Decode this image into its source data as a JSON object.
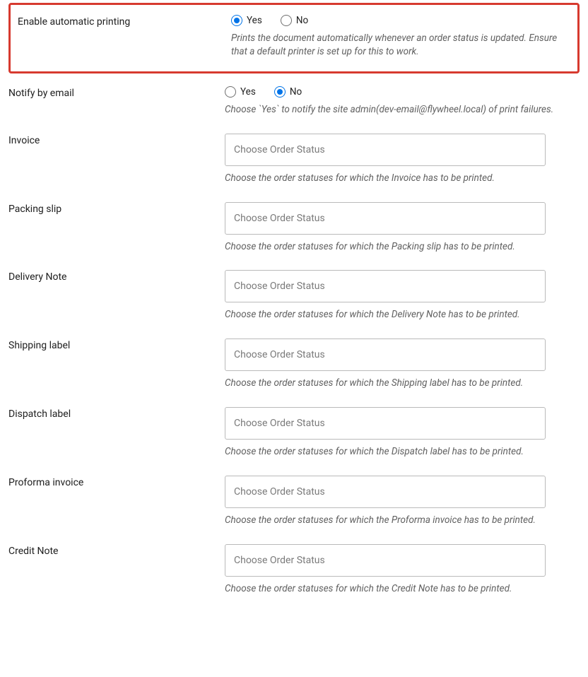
{
  "enable_printing": {
    "label": "Enable automatic printing",
    "yes": "Yes",
    "no": "No",
    "selected": "yes",
    "desc": "Prints the document automatically whenever an order status is updated. Ensure that a default printer is set up for this to work."
  },
  "notify_email": {
    "label": "Notify by email",
    "yes": "Yes",
    "no": "No",
    "selected": "no",
    "desc": "Choose `Yes` to notify the site admin(dev-email@flywheel.local) of print failures."
  },
  "placeholder": "Choose Order Status",
  "docs": {
    "invoice": {
      "label": "Invoice",
      "desc": "Choose the order statuses for which the Invoice has to be printed."
    },
    "packing": {
      "label": "Packing slip",
      "desc": "Choose the order statuses for which the Packing slip has to be printed."
    },
    "delivery": {
      "label": "Delivery Note",
      "desc": "Choose the order statuses for which the Delivery Note has to be printed."
    },
    "shipping": {
      "label": "Shipping label",
      "desc": "Choose the order statuses for which the Shipping label has to be printed."
    },
    "dispatch": {
      "label": "Dispatch label",
      "desc": "Choose the order statuses for which the Dispatch label has to be printed."
    },
    "proforma": {
      "label": "Proforma invoice",
      "desc": "Choose the order statuses for which the Proforma invoice has to be printed."
    },
    "credit": {
      "label": "Credit Note",
      "desc": "Choose the order statuses for which the Credit Note has to be printed."
    }
  }
}
